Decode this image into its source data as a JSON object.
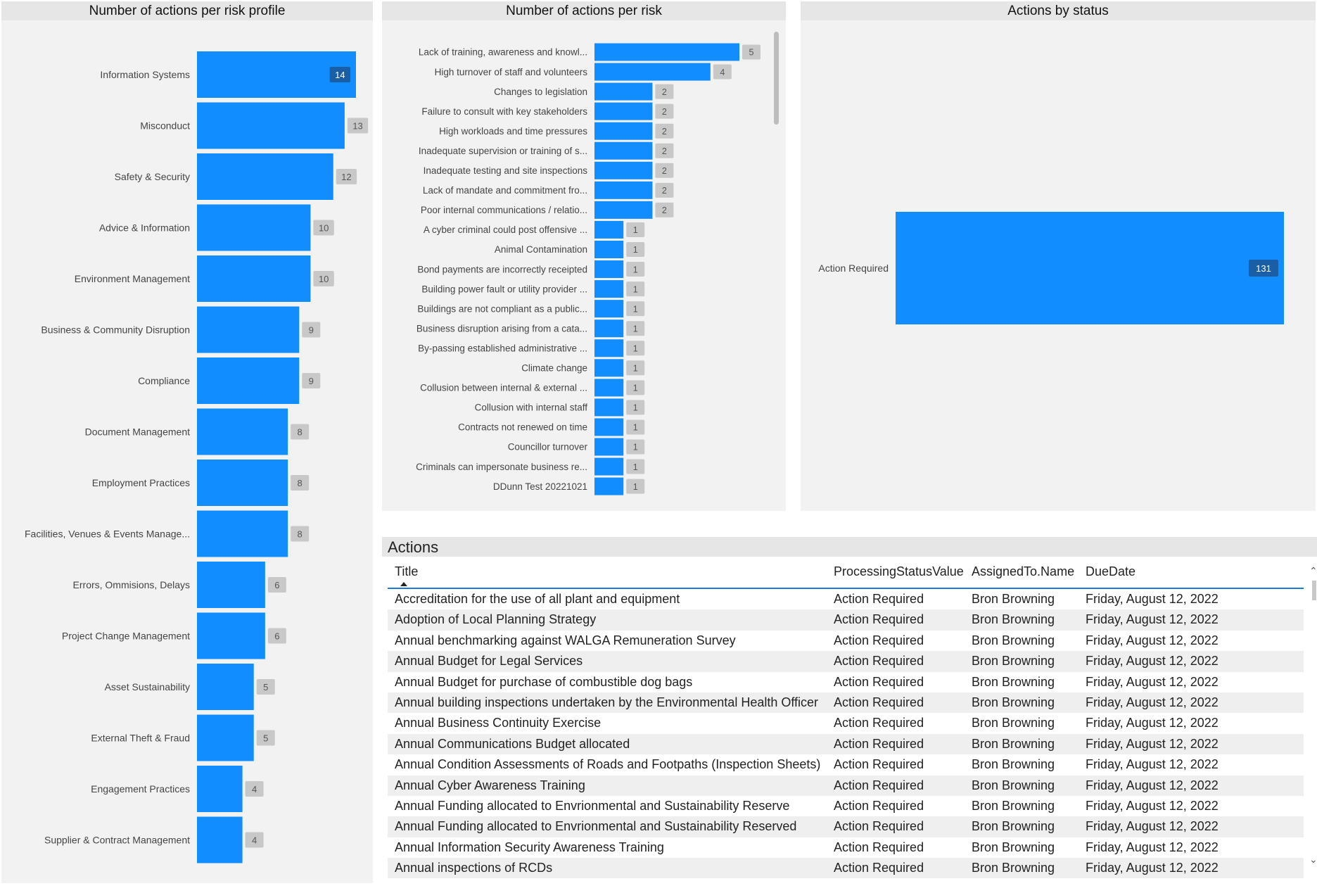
{
  "colors": {
    "bar": "#118DFF",
    "label_bg": "#c8c8c8",
    "label_bg_inside": "#1a5fa6"
  },
  "chart_data": [
    {
      "type": "bar",
      "orientation": "horizontal",
      "title": "Number of actions per risk profile",
      "categories": [
        "Information Systems",
        "Misconduct",
        "Safety & Security",
        "Advice & Information",
        "Environment Management",
        "Business & Community Disruption",
        "Compliance",
        "Document Management",
        "Employment Practices",
        "Facilities, Venues & Events Manage...",
        "Errors, Ommisions, Delays",
        "Project Change Management",
        "Asset Sustainability",
        "External Theft & Fraud",
        "Engagement Practices",
        "Supplier & Contract Management"
      ],
      "values": [
        14,
        13,
        12,
        10,
        10,
        9,
        9,
        8,
        8,
        8,
        6,
        6,
        5,
        5,
        4,
        4
      ],
      "value_labels": [
        "14",
        "13",
        "12",
        "10",
        "10",
        "9",
        "9",
        "8",
        "8",
        "8",
        "6",
        "6",
        "5",
        "5",
        "4",
        "4"
      ],
      "xlim": [
        0,
        14
      ]
    },
    {
      "type": "bar",
      "orientation": "horizontal",
      "title": "Number of actions per risk",
      "categories": [
        "Lack of training, awareness and knowl...",
        "High turnover of staff and volunteers",
        "Changes to legislation",
        "Failure to consult with key stakeholders",
        "High workloads and time pressures",
        "Inadequate supervision or training of s...",
        "Inadequate testing and site inspections",
        "Lack of mandate and commitment fro...",
        "Poor internal communications / relatio...",
        "A cyber criminal could post offensive ...",
        "Animal Contamination",
        "Bond payments are incorrectly receipted",
        "Building power fault or utility provider ...",
        "Buildings are not compliant as a public...",
        "Business disruption arising from a cata...",
        "By-passing established administrative ...",
        "Climate change",
        "Collusion between internal & external ...",
        "Collusion with internal staff",
        "Contracts not renewed on time",
        "Councillor turnover",
        "Criminals can impersonate business re...",
        "DDunn Test 20221021"
      ],
      "values": [
        5,
        4,
        2,
        2,
        2,
        2,
        2,
        2,
        2,
        1,
        1,
        1,
        1,
        1,
        1,
        1,
        1,
        1,
        1,
        1,
        1,
        1,
        1
      ],
      "value_labels": [
        "5",
        "4",
        "2",
        "2",
        "2",
        "2",
        "2",
        "2",
        "2",
        "1",
        "1",
        "1",
        "1",
        "1",
        "1",
        "1",
        "1",
        "1",
        "1",
        "1",
        "1",
        "1",
        "1"
      ],
      "xlim": [
        0,
        5
      ]
    },
    {
      "type": "bar",
      "orientation": "horizontal",
      "title": "Actions by status",
      "categories": [
        "Action Required"
      ],
      "values": [
        131
      ],
      "value_labels": [
        "131"
      ],
      "xlim": [
        0,
        131
      ]
    }
  ],
  "table": {
    "title": "Actions",
    "columns": [
      "Title",
      "ProcessingStatusValue",
      "AssignedTo.Name",
      "DueDate"
    ],
    "rows": [
      [
        "Accreditation for the use of all plant and equipment",
        "Action Required",
        "Bron Browning",
        "Friday, August 12, 2022"
      ],
      [
        "Adoption of Local Planning Strategy",
        "Action Required",
        "Bron Browning",
        "Friday, August 12, 2022"
      ],
      [
        "Annual benchmarking against WALGA Remuneration Survey",
        "Action Required",
        "Bron Browning",
        "Friday, August 12, 2022"
      ],
      [
        "Annual Budget for Legal Services",
        "Action Required",
        "Bron Browning",
        "Friday, August 12, 2022"
      ],
      [
        "Annual Budget for purchase of combustible dog bags",
        "Action Required",
        "Bron Browning",
        "Friday, August 12, 2022"
      ],
      [
        "Annual building inspections undertaken by the Environmental Health Officer",
        "Action Required",
        "Bron Browning",
        "Friday, August 12, 2022"
      ],
      [
        "Annual Business Continuity Exercise",
        "Action Required",
        "Bron Browning",
        "Friday, August 12, 2022"
      ],
      [
        "Annual Communications Budget allocated",
        "Action Required",
        "Bron Browning",
        "Friday, August 12, 2022"
      ],
      [
        "Annual Condition Assessments of Roads and Footpaths (Inspection Sheets)",
        "Action Required",
        "Bron Browning",
        "Friday, August 12, 2022"
      ],
      [
        "Annual Cyber Awareness Training",
        "Action Required",
        "Bron Browning",
        "Friday, August 12, 2022"
      ],
      [
        "Annual Funding allocated to Envrionmental and Sustainability Reserve",
        "Action Required",
        "Bron Browning",
        "Friday, August 12, 2022"
      ],
      [
        "Annual Funding allocated to Envrionmental and Sustainability Reserved",
        "Action Required",
        "Bron Browning",
        "Friday, August 12, 2022"
      ],
      [
        "Annual Information Security Awareness Training",
        "Action Required",
        "Bron Browning",
        "Friday, August 12, 2022"
      ],
      [
        "Annual inspections of RCDs",
        "Action Required",
        "Bron Browning",
        "Friday, August 12, 2022"
      ]
    ]
  }
}
